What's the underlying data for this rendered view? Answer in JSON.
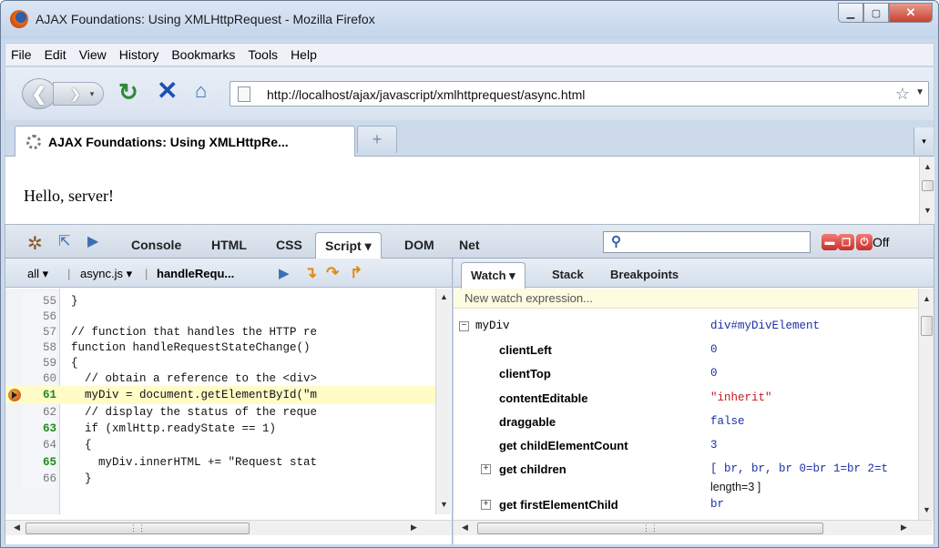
{
  "window": {
    "title": "AJAX Foundations: Using XMLHttpRequest - Mozilla Firefox"
  },
  "menu": [
    "File",
    "Edit",
    "View",
    "History",
    "Bookmarks",
    "Tools",
    "Help"
  ],
  "nav": {
    "url": "http://localhost/ajax/javascript/xmlhttprequest/async.html"
  },
  "tab": {
    "title": "AJAX Foundations: Using XMLHttpRe..."
  },
  "page": {
    "text": "Hello, server!"
  },
  "firebug": {
    "tabs": [
      "Console",
      "HTML",
      "CSS",
      "Script ▾",
      "DOM",
      "Net"
    ],
    "off": "Off",
    "script_bar": {
      "all": "all ▾",
      "file": "async.js ▾",
      "fn": "handleRequ..."
    },
    "code": [
      {
        "n": "55",
        "text": "}"
      },
      {
        "n": "56",
        "text": ""
      },
      {
        "n": "57",
        "text": "// function that handles the HTTP re"
      },
      {
        "n": "58",
        "text": "function handleRequestStateChange()"
      },
      {
        "n": "59",
        "text": "{"
      },
      {
        "n": "60",
        "text": "  // obtain a reference to the <div>"
      },
      {
        "n": "61",
        "text": "  myDiv = document.getElementById(\"m"
      },
      {
        "n": "62",
        "text": "  // display the status of the reque"
      },
      {
        "n": "63",
        "text": "  if (xmlHttp.readyState == 1)"
      },
      {
        "n": "64",
        "text": "  {"
      },
      {
        "n": "65",
        "text": "    myDiv.innerHTML += \"Request stat"
      },
      {
        "n": "66",
        "text": "  }"
      }
    ],
    "watch_tabs": [
      "Watch ▾",
      "Stack",
      "Breakpoints"
    ],
    "new_watch": "New watch expression...",
    "watch": [
      {
        "name": "myDiv",
        "value": "div#myDivElement"
      },
      {
        "name": "clientLeft",
        "value": "0"
      },
      {
        "name": "clientTop",
        "value": "0"
      },
      {
        "name": "contentEditable",
        "value": "\"inherit\""
      },
      {
        "name": "draggable",
        "value": "false"
      },
      {
        "name": "get childElementCount",
        "value": "3"
      },
      {
        "name": "get children",
        "value": "[ br, br, br 0=br 1=br 2=t"
      },
      {
        "name": "get firstElementChild",
        "value": "br"
      }
    ],
    "children_line2": "length=3 ]"
  }
}
